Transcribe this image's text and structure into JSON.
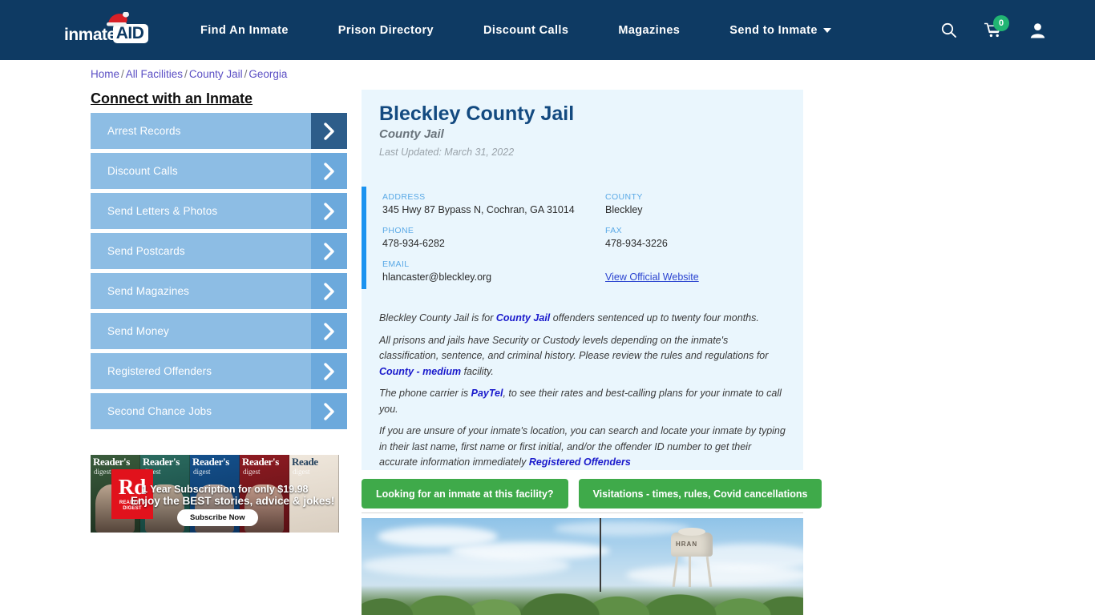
{
  "header": {
    "logo": {
      "part1": "inmate",
      "part2": "AID",
      "hat_icon": "santa-hat-icon"
    },
    "nav": [
      {
        "label": "Find An Inmate",
        "has_caret": false
      },
      {
        "label": "Prison Directory",
        "has_caret": false
      },
      {
        "label": "Discount Calls",
        "has_caret": false
      },
      {
        "label": "Magazines",
        "has_caret": false
      },
      {
        "label": "Send to Inmate",
        "has_caret": true
      }
    ],
    "icons": {
      "search": "search-icon",
      "cart": "shopping-cart-icon",
      "cart_count": "0",
      "account": "user-account-icon"
    },
    "colors": {
      "bar_bg": "#0e3a63",
      "badge": "#21b573"
    }
  },
  "breadcrumb": {
    "items": [
      "Home",
      "All Facilities",
      "County Jail",
      "Georgia"
    ],
    "separator": "/"
  },
  "sidebar": {
    "title": "Connect with an Inmate",
    "items": [
      {
        "label": "Arrest Records",
        "active": true
      },
      {
        "label": "Discount Calls",
        "active": false
      },
      {
        "label": "Send Letters & Photos",
        "active": false
      },
      {
        "label": "Send Postcards",
        "active": false
      },
      {
        "label": "Send Magazines",
        "active": false
      },
      {
        "label": "Send Money",
        "active": false
      },
      {
        "label": "Registered Offenders",
        "active": false
      },
      {
        "label": "Second Chance Jobs",
        "active": false
      }
    ],
    "colors": {
      "button_bg": "#8dbde4",
      "arrow_bg": "#6ca9dc",
      "arrow_active_bg": "#2d5d8a"
    }
  },
  "ad": {
    "brand": "Rd",
    "brand_sub": "READER'S DIGEST",
    "line1": "1 Year Subscription for only $19.98",
    "line2": "Enjoy the BEST stories, advice & jokes!",
    "cta": "Subscribe Now",
    "covers": [
      {
        "title": "Reader's",
        "sub": "digest"
      },
      {
        "title": "Reader's",
        "sub": "digest"
      },
      {
        "title": "Reader's",
        "sub": "digest"
      },
      {
        "title": "Reader's",
        "sub": "digest"
      },
      {
        "title": "Reade",
        "sub": "digest"
      }
    ]
  },
  "facility": {
    "name": "Bleckley County Jail",
    "type": "County Jail",
    "last_updated": "Last Updated: March 31, 2022",
    "contact": {
      "address_label": "ADDRESS",
      "address_value": "345 Hwy 87 Bypass N, Cochran, GA 31014",
      "county_label": "COUNTY",
      "county_value": "Bleckley",
      "phone_label": "PHONE",
      "phone_value": "478-934-6282",
      "fax_label": "FAX",
      "fax_value": "478-934-3226",
      "email_label": "EMAIL",
      "email_value": "hlancaster@bleckley.org",
      "website_link": "View Official Website"
    }
  },
  "description": {
    "p1_a": "Bleckley County Jail is for ",
    "p1_link": "County Jail",
    "p1_b": " offenders sentenced up to twenty four months.",
    "p2_a": "All prisons and jails have Security or Custody levels depending on the inmate's classification, sentence, and criminal history. Please review the rules and regulations for ",
    "p2_link": "County - medium",
    "p2_b": " facility.",
    "p3_a": "The phone carrier is ",
    "p3_link": "PayTel",
    "p3_b": ", to see their rates and best-calling plans for your inmate to call you.",
    "p4_a": "If you are unsure of your inmate's location, you can search and locate your inmate by typing in their last name, first name or first initial, and/or the offender ID number to get their accurate information immediately ",
    "p4_link": "Registered Offenders"
  },
  "actions": {
    "inmate_search": "Looking for an inmate at this facility?",
    "visitations": "Visitations - times, rules, Covid cancellations",
    "color": "#3faa4a"
  },
  "photo": {
    "alt": "facility-street-view-photo",
    "tower_label": "HRAN"
  }
}
